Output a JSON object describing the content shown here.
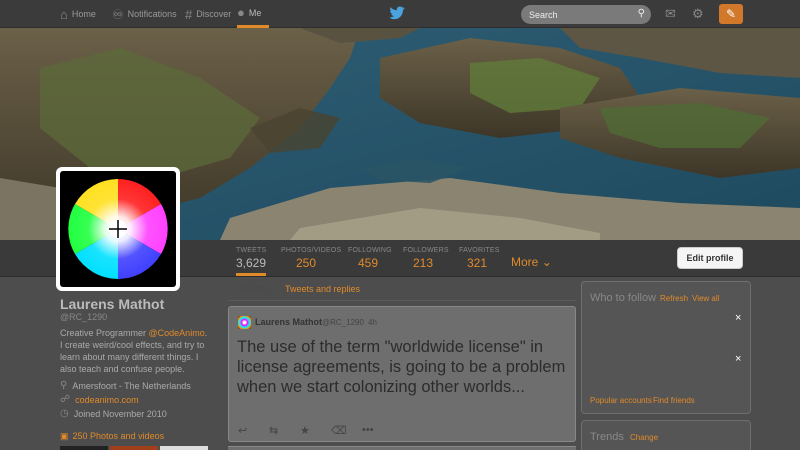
{
  "nav": {
    "home": "Home",
    "notifications": "Notifications",
    "discover": "Discover",
    "me": "Me",
    "search_placeholder": "Search",
    "accent_color": "#e08a2a"
  },
  "stats": {
    "tweets_label": "TWEETS",
    "tweets_value": "3,629",
    "photos_label": "PHOTOS/VIDEOS",
    "photos_value": "250",
    "following_label": "FOLLOWING",
    "following_value": "459",
    "followers_label": "FOLLOWERS",
    "followers_value": "213",
    "favorites_label": "FAVORITES",
    "favorites_value": "321",
    "more_label": "More"
  },
  "edit_profile": "Edit profile",
  "profile": {
    "name": "Laurens Mathot",
    "handle": "@RC_1290",
    "bio_prefix": "Creative Programmer ",
    "bio_mention": "@CodeAnimo",
    "bio_suffix": ". I create weird/cool effects, and try to learn about many different things. I also teach and confuse people.",
    "location": "Amersfoort - The Netherlands",
    "website": "codeanimo.com",
    "joined": "Joined November 2010",
    "photos_videos": "250 Photos and videos"
  },
  "timeline": {
    "tab_tweets": "Tweets",
    "tab_replies": "Tweets and replies"
  },
  "tweet": {
    "name": "Laurens Mathot",
    "handle": "@RC_1290",
    "time": "4h",
    "text": "The use of the term \"worldwide license\" in license agreements, is going to be a problem when we start colonizing other worlds..."
  },
  "who_to_follow": {
    "title": "Who to follow",
    "refresh": "Refresh",
    "view_all": "View all",
    "dismiss": "×",
    "popular": "Popular accounts",
    "find_friends": "Find friends"
  },
  "trends": {
    "title": "Trends",
    "change": "Change"
  }
}
